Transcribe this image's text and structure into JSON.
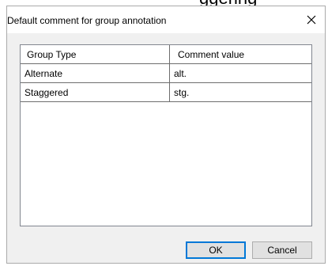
{
  "background_text": "ggering",
  "dialog": {
    "title": "Default comment for group annotation",
    "close_icon": "close-icon"
  },
  "table": {
    "columns": [
      "Group Type",
      "Comment value"
    ],
    "rows": [
      [
        "Alternate",
        "alt."
      ],
      [
        "Staggered",
        "stg."
      ]
    ]
  },
  "buttons": {
    "ok": "OK",
    "cancel": "Cancel"
  },
  "colors": {
    "dialog_bg": "#f0f0f0",
    "titlebar_bg": "#ffffff",
    "accent": "#0078d7"
  }
}
